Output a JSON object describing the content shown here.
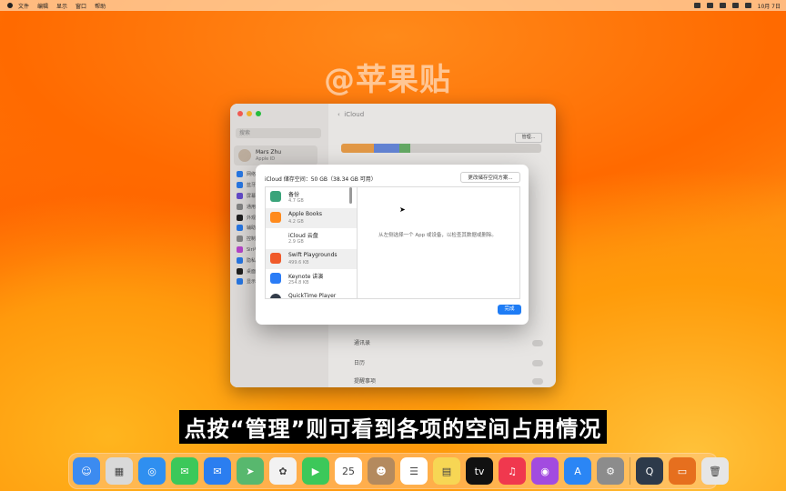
{
  "menubar": {
    "items": [
      "文件",
      "编辑",
      "显示",
      "窗口",
      "帮助"
    ],
    "clock": "10月 7日"
  },
  "watermark": "@苹果贴",
  "settings": {
    "search_placeholder": "搜索",
    "user_name": "Mars Zhu",
    "user_sub": "Apple ID",
    "page_title": "iCloud",
    "manage_button": "管理...",
    "rows": [
      "通讯录",
      "日历",
      "提醒事项"
    ],
    "sidebar_labels": [
      "网络",
      "蓝牙",
      "屏幕使用时间",
      "通用",
      "外观",
      "辅助功能",
      "控制中心",
      "Siri与聚焦",
      "隐私与安全性",
      "桌面与程序坞",
      "显示器"
    ]
  },
  "dialog": {
    "title": "iCloud 储存空间：50 GB（38.34 GB 可用）",
    "top_button": "更改储存空间方案...",
    "apps": [
      {
        "name": "备份",
        "size": "4.7 GB",
        "color": "#3aa47a"
      },
      {
        "name": "Apple Books",
        "size": "4.2 GB",
        "color": "#ff8a1c"
      },
      {
        "name": "iCloud 云盘",
        "size": "2.9 GB",
        "color": "#ffffff"
      },
      {
        "name": "Swift Playgrounds",
        "size": "499.6 KB",
        "color": "#f05a2a"
      },
      {
        "name": "Keynote 讲演",
        "size": "254.8 KB",
        "color": "#2a7cf6"
      },
      {
        "name": "QuickTime Player",
        "size": "",
        "color": "#333c4a"
      }
    ],
    "hint": "从左侧选择一个 App 或设备，以检查其数据或删除。",
    "done_button": "完成"
  },
  "subtitle": "点按“管理”则可看到各项的空间占用情况",
  "dock": [
    {
      "name": "finder-icon",
      "color": "#3c8bf0",
      "glyph": "☺"
    },
    {
      "name": "launchpad-icon",
      "color": "#d9d9d9",
      "glyph": "▦"
    },
    {
      "name": "safari-icon",
      "color": "#2f8ff0",
      "glyph": "◎"
    },
    {
      "name": "messages-icon",
      "color": "#3cc85a",
      "glyph": "✉"
    },
    {
      "name": "mail-icon",
      "color": "#2b7ef0",
      "glyph": "✉"
    },
    {
      "name": "maps-icon",
      "color": "#58b86e",
      "glyph": "➤"
    },
    {
      "name": "photos-icon",
      "color": "#f2f2f2",
      "glyph": "✿"
    },
    {
      "name": "facetime-icon",
      "color": "#3cc85a",
      "glyph": "▶"
    },
    {
      "name": "calendar-icon",
      "color": "#ffffff",
      "glyph": "25"
    },
    {
      "name": "contacts-icon",
      "color": "#b48a5e",
      "glyph": "☻"
    },
    {
      "name": "reminders-icon",
      "color": "#ffffff",
      "glyph": "☰"
    },
    {
      "name": "notes-icon",
      "color": "#f7d654",
      "glyph": "▤"
    },
    {
      "name": "tv-icon",
      "color": "#111111",
      "glyph": "tv"
    },
    {
      "name": "music-icon",
      "color": "#f0384e",
      "glyph": "♫"
    },
    {
      "name": "podcasts-icon",
      "color": "#a24be0",
      "glyph": "◉"
    },
    {
      "name": "app-store-icon",
      "color": "#2b86f5",
      "glyph": "A"
    },
    {
      "name": "system-settings-icon",
      "color": "#8c8c8c",
      "glyph": "⚙"
    },
    {
      "name": "quicktime-icon",
      "color": "#2d3a4a",
      "glyph": "Q"
    },
    {
      "name": "folder-icon",
      "color": "#e66f1e",
      "glyph": "▭"
    },
    {
      "name": "trash-icon",
      "color": "#e6e6e6",
      "glyph": "🗑"
    }
  ]
}
